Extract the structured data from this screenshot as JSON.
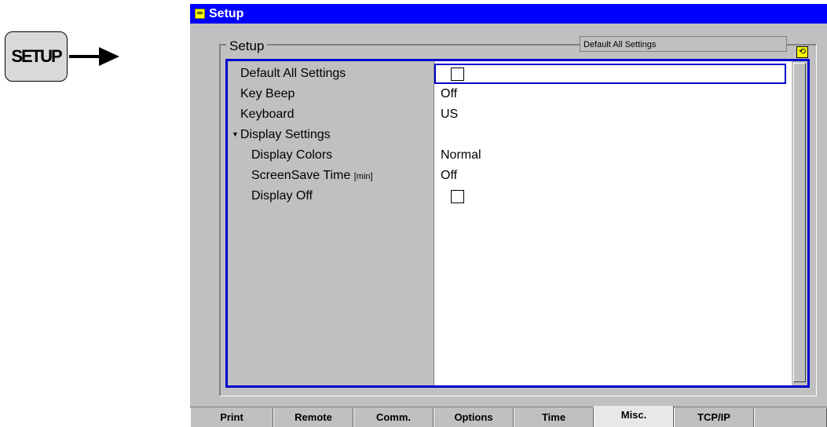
{
  "hardkey": {
    "label": "SETUP"
  },
  "window": {
    "title": "Setup",
    "group_title": "Setup",
    "status_text": "Default All Settings",
    "refresh_icon": "refresh-icon"
  },
  "rows": [
    {
      "label": "Default All Settings",
      "value_type": "checkbox",
      "checked": false
    },
    {
      "label": "Key Beep",
      "value": "Off"
    },
    {
      "label": "Keyboard",
      "value": "US"
    },
    {
      "label": "Display Settings",
      "expanded": true
    },
    {
      "label": "Display Colors",
      "value": "Normal"
    },
    {
      "label": "ScreenSave Time",
      "unit": "[min]",
      "value": "Off"
    },
    {
      "label": "Display Off",
      "value_type": "checkbox",
      "checked": false
    }
  ],
  "tabs": [
    "Print",
    "Remote",
    "Comm.",
    "Options",
    "Time",
    "Misc.",
    "TCP/IP",
    ""
  ],
  "active_tab": "Misc.",
  "colors": {
    "titlebar": "#0000ff",
    "frame": "#0000cc",
    "background": "#c0c0c0"
  }
}
